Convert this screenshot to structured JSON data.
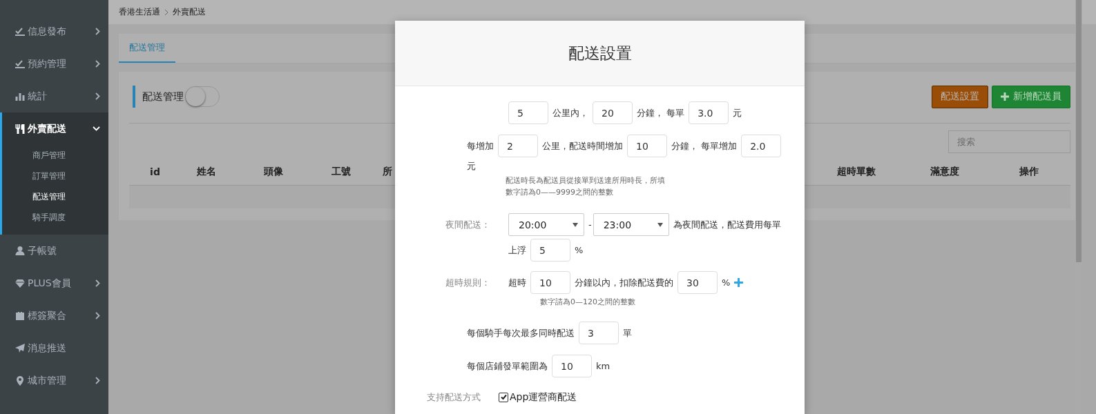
{
  "breadcrumb": [
    "香港生活通",
    "外賣配送"
  ],
  "sidebar": {
    "items": [
      {
        "label": "信息發布",
        "kind": "menu",
        "expanded": false
      },
      {
        "label": "預約管理",
        "kind": "menu",
        "expanded": false
      },
      {
        "label": "統計",
        "kind": "menu",
        "expanded": false
      },
      {
        "label": "外賣配送",
        "kind": "menu",
        "expanded": true,
        "children": [
          {
            "label": "商戶管理",
            "selected": false
          },
          {
            "label": "訂單管理",
            "selected": false
          },
          {
            "label": "配送管理",
            "selected": true
          },
          {
            "label": "騎手調度",
            "selected": false
          }
        ]
      },
      {
        "label": "子帳號",
        "kind": "link"
      },
      {
        "label": "PLUS會員",
        "kind": "menu",
        "expanded": false
      },
      {
        "label": "標簽聚合",
        "kind": "menu",
        "expanded": false
      },
      {
        "label": "消息推送",
        "kind": "link"
      },
      {
        "label": "城市管理",
        "kind": "menu",
        "expanded": false
      }
    ]
  },
  "tabs": [
    {
      "label": "配送管理",
      "selected": true
    }
  ],
  "panel": {
    "title": "配送管理",
    "switch_on": false,
    "buttons": [
      {
        "label": "配送設置",
        "kind": "settings"
      },
      {
        "label": "新增配送員",
        "kind": "add"
      }
    ],
    "search": {
      "placeholder": "搜索"
    },
    "table": {
      "columns": [
        "id",
        "姓名",
        "頭像",
        "工號",
        "所",
        "超時單數",
        "滿意度",
        "操作"
      ]
    }
  },
  "dialog": {
    "title": "配送設置",
    "rows": [
      {
        "lines": [
          [
            {
              "kind": "input",
              "value": "5"
            },
            {
              "kind": "text",
              "text": "公里內，"
            },
            {
              "kind": "input",
              "value": "20"
            },
            {
              "kind": "text",
              "text": "分鐘， 每單"
            },
            {
              "kind": "input",
              "value": "3.0"
            },
            {
              "kind": "text",
              "text": "元"
            }
          ]
        ]
      },
      {
        "lines": [
          [
            {
              "kind": "text",
              "text": "每增加"
            },
            {
              "kind": "input",
              "value": "2"
            },
            {
              "kind": "text",
              "text": "公里，配送時間增加"
            },
            {
              "kind": "input",
              "value": "10"
            },
            {
              "kind": "text",
              "text": "分鐘， 每單增加"
            },
            {
              "kind": "input",
              "value": "2.0"
            }
          ],
          [
            {
              "kind": "text",
              "text": "元"
            }
          ]
        ],
        "hint": [
          "配送時長為配送員從接單到送達所用時長，所填",
          "數字請為0——9999之間的整數"
        ]
      },
      {
        "label": "夜間配送：",
        "lines": [
          [
            {
              "kind": "select",
              "value": "20:00"
            },
            {
              "kind": "text",
              "text": "-"
            },
            {
              "kind": "select",
              "value": "23:00"
            },
            {
              "kind": "text",
              "text": "為夜間配送，配送費用每單"
            }
          ],
          [
            {
              "kind": "text",
              "text": "上浮"
            },
            {
              "kind": "input",
              "value": "5"
            },
            {
              "kind": "text",
              "text": "%"
            }
          ]
        ]
      },
      {
        "label": "超時規則：",
        "lines": [
          [
            {
              "kind": "text",
              "text": "超時"
            },
            {
              "kind": "input",
              "value": "10"
            },
            {
              "kind": "text",
              "text": "分鐘以內，扣除配送費的"
            },
            {
              "kind": "input",
              "value": "30"
            },
            {
              "kind": "text",
              "text": "%"
            },
            {
              "kind": "plus"
            }
          ]
        ],
        "hint": [
          "數字請為0—120之間的整數"
        ]
      },
      {
        "lines": [
          [
            {
              "kind": "text",
              "text": "每個騎手每次最多同時配送"
            },
            {
              "kind": "input",
              "value": "3"
            },
            {
              "kind": "text",
              "text": "單"
            }
          ]
        ]
      },
      {
        "lines": [
          [
            {
              "kind": "text",
              "text": "每個店鋪發單範圍為"
            },
            {
              "kind": "input",
              "value": "10"
            },
            {
              "kind": "text",
              "text": "km"
            }
          ]
        ]
      },
      {
        "label": "支持配送方式",
        "lines": [
          [
            {
              "kind": "checkbox",
              "text": "App運營商配送",
              "checked": true
            }
          ]
        ]
      }
    ]
  }
}
